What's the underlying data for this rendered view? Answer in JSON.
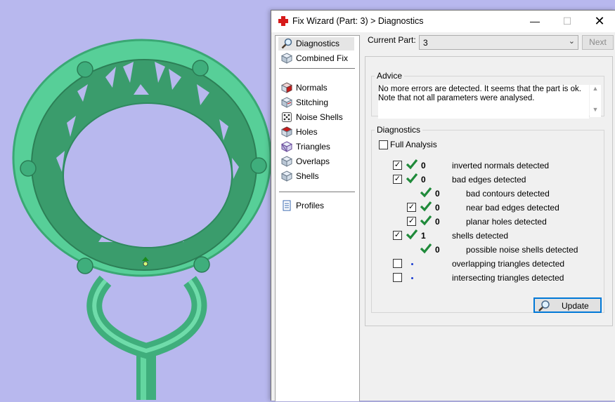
{
  "window": {
    "title": "Fix Wizard (Part: 3) > Diagnostics",
    "controls": {
      "minimize": "—",
      "maximize": "☐",
      "close": "✕"
    }
  },
  "nav": {
    "items": [
      {
        "label": "Diagnostics",
        "icon": "magnifier-icon",
        "selected": true
      },
      {
        "label": "Combined Fix",
        "icon": "cube-icon"
      },
      {
        "label": "Normals",
        "icon": "red-cube-icon"
      },
      {
        "label": "Stitching",
        "icon": "cube-stitch-icon"
      },
      {
        "label": "Noise Shells",
        "icon": "dice-icon"
      },
      {
        "label": "Holes",
        "icon": "red-cube-icon"
      },
      {
        "label": "Triangles",
        "icon": "triangle-cube-icon"
      },
      {
        "label": "Overlaps",
        "icon": "cube-icon"
      },
      {
        "label": "Shells",
        "icon": "cube-icon"
      },
      {
        "label": "Profiles",
        "icon": "document-icon"
      }
    ]
  },
  "current_part": {
    "label": "Current Part:",
    "value": "3"
  },
  "next_button": "Next",
  "advice": {
    "legend": "Advice",
    "line1": "No more errors are detected. It seems that the part is ok.",
    "line2": "Note that not all parameters were analysed."
  },
  "diagnostics": {
    "legend": "Diagnostics",
    "full_analysis": {
      "label": "Full Analysis",
      "checked": false
    },
    "rows": [
      {
        "checked": true,
        "status": "ok",
        "count": "0",
        "label": "inverted normals detected"
      },
      {
        "checked": true,
        "status": "ok",
        "count": "0",
        "label": "bad edges detected"
      },
      {
        "checked": null,
        "status": "ok",
        "count": "0",
        "label": "bad contours detected"
      },
      {
        "checked": true,
        "status": "ok",
        "count": "0",
        "label": "near bad edges detected"
      },
      {
        "checked": true,
        "status": "ok",
        "count": "0",
        "label": "planar holes detected"
      },
      {
        "checked": true,
        "status": "ok",
        "count": "1",
        "label": "shells detected"
      },
      {
        "checked": null,
        "status": "ok",
        "count": "0",
        "label": "possible noise shells detected"
      },
      {
        "checked": false,
        "status": "pending",
        "count": "",
        "label": "overlapping triangles detected"
      },
      {
        "checked": false,
        "status": "pending",
        "count": "",
        "label": "intersecting triangles detected"
      }
    ],
    "update_button": "Update"
  },
  "colors": {
    "viewport_bg": "#b8b8ee",
    "model_green": "#4fc48e",
    "check_green": "#1f8a3a",
    "accent_blue": "#0078d7"
  }
}
